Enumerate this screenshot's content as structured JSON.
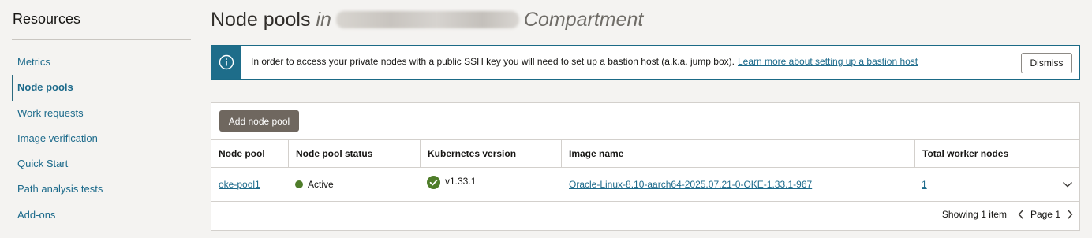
{
  "sidebar": {
    "title": "Resources",
    "items": [
      {
        "label": "Metrics",
        "active": false
      },
      {
        "label": "Node pools",
        "active": true
      },
      {
        "label": "Work requests",
        "active": false
      },
      {
        "label": "Image verification",
        "active": false
      },
      {
        "label": "Quick Start",
        "active": false
      },
      {
        "label": "Path analysis tests",
        "active": false
      },
      {
        "label": "Add-ons",
        "active": false
      }
    ]
  },
  "header": {
    "title": "Node pools",
    "in": "in",
    "compartment": "Compartment"
  },
  "banner": {
    "icon": "info-icon",
    "message": "In order to access your private nodes with a public SSH key you will need to set up a bastion host (a.k.a. jump box).",
    "link": "Learn more about setting up a bastion host",
    "dismiss": "Dismiss"
  },
  "table": {
    "add_button": "Add node pool",
    "columns": [
      "Node pool",
      "Node pool status",
      "Kubernetes version",
      "Image name",
      "Total worker nodes"
    ],
    "rows": [
      {
        "node_pool": "oke-pool1",
        "status": "Active",
        "version": "v1.33.1",
        "image": "Oracle-Linux-8.10-aarch64-2025.07.21-0-OKE-1.33.1-967",
        "workers": "1"
      }
    ],
    "footer": {
      "showing": "Showing 1 item",
      "page": "Page 1"
    }
  },
  "colors": {
    "accent": "#1c6a8b",
    "status_active": "#4f7d2a",
    "check_green": "#4f7d2a",
    "button_dark": "#6f675f"
  }
}
